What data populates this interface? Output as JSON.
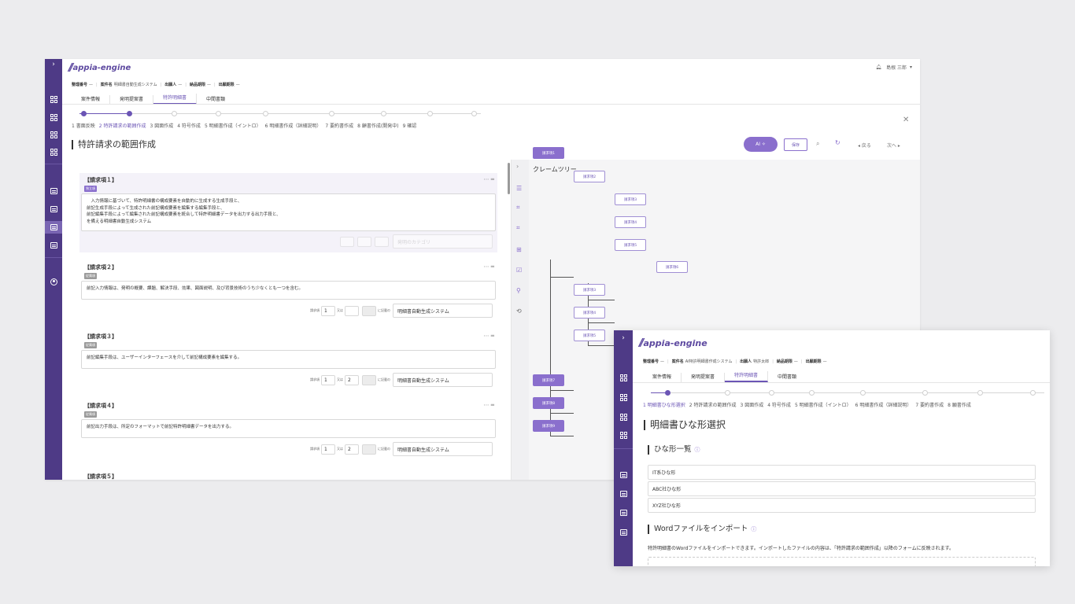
{
  "back": {
    "logo": "appia-engine",
    "user": "島根 三郎",
    "meta": [
      {
        "label": "整理番号",
        "value": "—"
      },
      {
        "label": "案件名",
        "value": "明細書自動生成システム"
      },
      {
        "label": "出願人",
        "value": "—"
      },
      {
        "label": "納品期限",
        "value": "—"
      },
      {
        "label": "出願期限",
        "value": "—"
      }
    ],
    "tabs": [
      "案件情報",
      "発明提案書",
      "特許明細書",
      "中間書類"
    ],
    "steps": [
      "1 書面反映",
      "2 特許請求の範囲作成",
      "3 図面作成",
      "4 符号作成",
      "5 明細書作成（イントロ）",
      "6 明細書作成（詳細説明）",
      "7 要約書作成",
      "8 顧書作成(開発中)",
      "9 確認"
    ],
    "title": "特許請求の範囲作成",
    "ai_label": "AI ✧",
    "save_label": "保存",
    "prev_label": "◂ 戻る",
    "next_label": "次へ ▸",
    "close_label": "✕",
    "claims": [
      {
        "title": "【請求項１】",
        "badge": "独立項",
        "text": "　入力情報に基づいて、特許明細書の構成要素を自動的に生成する生成手段と、\n前記生成手段によって生成された前記構成要素を編集する編集手段と、\n前記編集手段によって編集された前記構成要素を統合して特許明細書データを出力する出力手段と、\nを備える明細書自動生成システム",
        "dep": "発明のカテゴリ"
      },
      {
        "title": "【請求項２】",
        "badge": "従属項",
        "text": "前記入力情報は、発明の概要、課題、解決手段、効果、図面説明、及び背景技術のうち少なくとも一つを含む。",
        "ref1": "1",
        "ref2": "",
        "ref3": "",
        "dep": "明細書自動生成システム"
      },
      {
        "title": "【請求項３】",
        "badge": "従属項",
        "text": "前記編集手段は、ユーザーインターフェースを介して前記構成要素を編集する。",
        "ref1": "1",
        "ref2": "2",
        "ref3": "",
        "dep": "明細書自動生成システム"
      },
      {
        "title": "【請求項４】",
        "badge": "従属項",
        "text": "前記出力手段は、所定のフォーマットで前記特許明細書データを出力する。",
        "ref1": "1",
        "ref2": "2",
        "ref3": "",
        "dep": "明細書自動生成システム"
      },
      {
        "title": "【請求項５】"
      }
    ],
    "ref_labels": {
      "claim": "請求項",
      "or": "又は",
      "suffix": "に記載の"
    },
    "tree_title": "クレームツリー",
    "tree_nodes": [
      "請求項1",
      "請求項2",
      "請求項3",
      "請求項4",
      "請求項5",
      "請求項6",
      "請求項3",
      "請求項4",
      "請求項5",
      "請求項7",
      "請求項8",
      "請求項9"
    ]
  },
  "front": {
    "logo": "appia-engine",
    "meta": [
      {
        "label": "整理番号",
        "value": "—"
      },
      {
        "label": "案件名",
        "value": "AI特許明細書作成システム"
      },
      {
        "label": "出願人",
        "value": "特許太郎"
      },
      {
        "label": "納品期限",
        "value": "—"
      },
      {
        "label": "出願期限",
        "value": "—"
      }
    ],
    "tabs": [
      "案件情報",
      "発明提案書",
      "特許明細書",
      "中間書類"
    ],
    "steps": [
      "1 明細書ひな形選択",
      "2 特許請求の範囲作成",
      "3 図面作成",
      "4 符号作成",
      "5 明細書作成（イントロ）",
      "6 明細書作成（詳細説明）",
      "7 要約書作成",
      "8 願書作成"
    ],
    "title": "明細書ひな形選択",
    "section1": "ひな形一覧",
    "templates": [
      "IT系ひな形",
      "ABC社ひな形",
      "XYZ社ひな形"
    ],
    "section2": "Wordファイルをインポート",
    "import_desc": "特許明細書のWordファイルをインポートできます。インポートしたファイルの内容は、「特許請求の範囲作成」以降のフォームに反映されます。"
  }
}
